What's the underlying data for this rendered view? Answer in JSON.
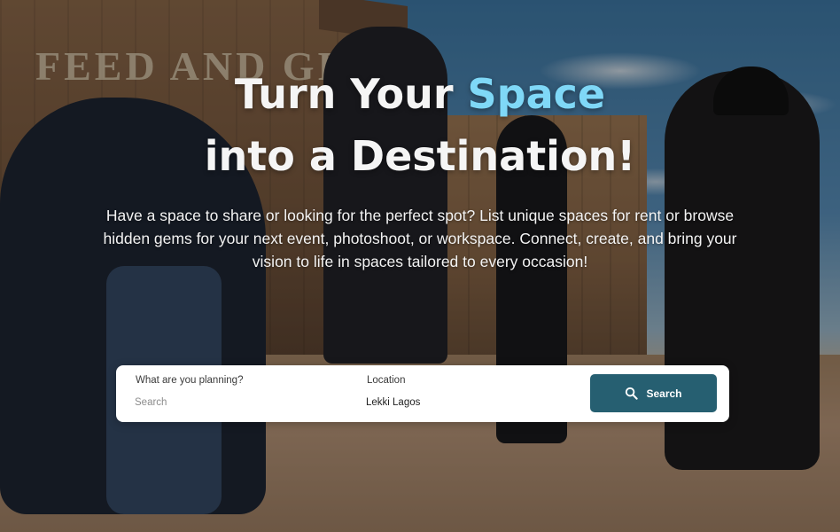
{
  "hero": {
    "title_part1": "Turn Your ",
    "title_accent": "Space",
    "title_line2": "into a Destination!",
    "description": "Have a space to share or looking for the perfect spot? List unique spaces for rent or browse hidden gems for your next event, photoshoot, or workspace. Connect, create, and bring your vision to life in spaces tailored to every occasion!",
    "accent_color": "#7fd8f7",
    "background_sign_text": "FEED AND GRAIN"
  },
  "search": {
    "planning_label": "What are you planning?",
    "planning_placeholder": "Search",
    "location_label": "Location",
    "location_value": "Lekki Lagos",
    "button_label": "Search",
    "button_icon": "search-icon",
    "button_color": "#265f71"
  }
}
